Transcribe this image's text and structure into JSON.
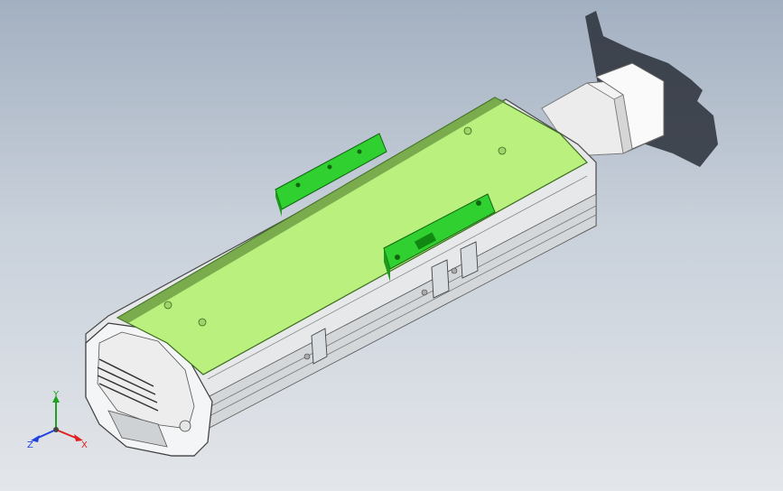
{
  "viewport": {
    "background_top": "#a3b0c1",
    "background_bottom": "#e3e6ea"
  },
  "model": {
    "body_color": "#e3e6ea",
    "cover_color": "#b6f07a",
    "bracket_color": "#2fd02f",
    "motor_color": "#f1f1f1",
    "shadow_color": "#2a2f38"
  },
  "triad": {
    "x_label": "X",
    "y_label": "Y",
    "z_label": "Z",
    "x_color": "#e02020",
    "y_color": "#20a020",
    "z_color": "#2040e0"
  }
}
